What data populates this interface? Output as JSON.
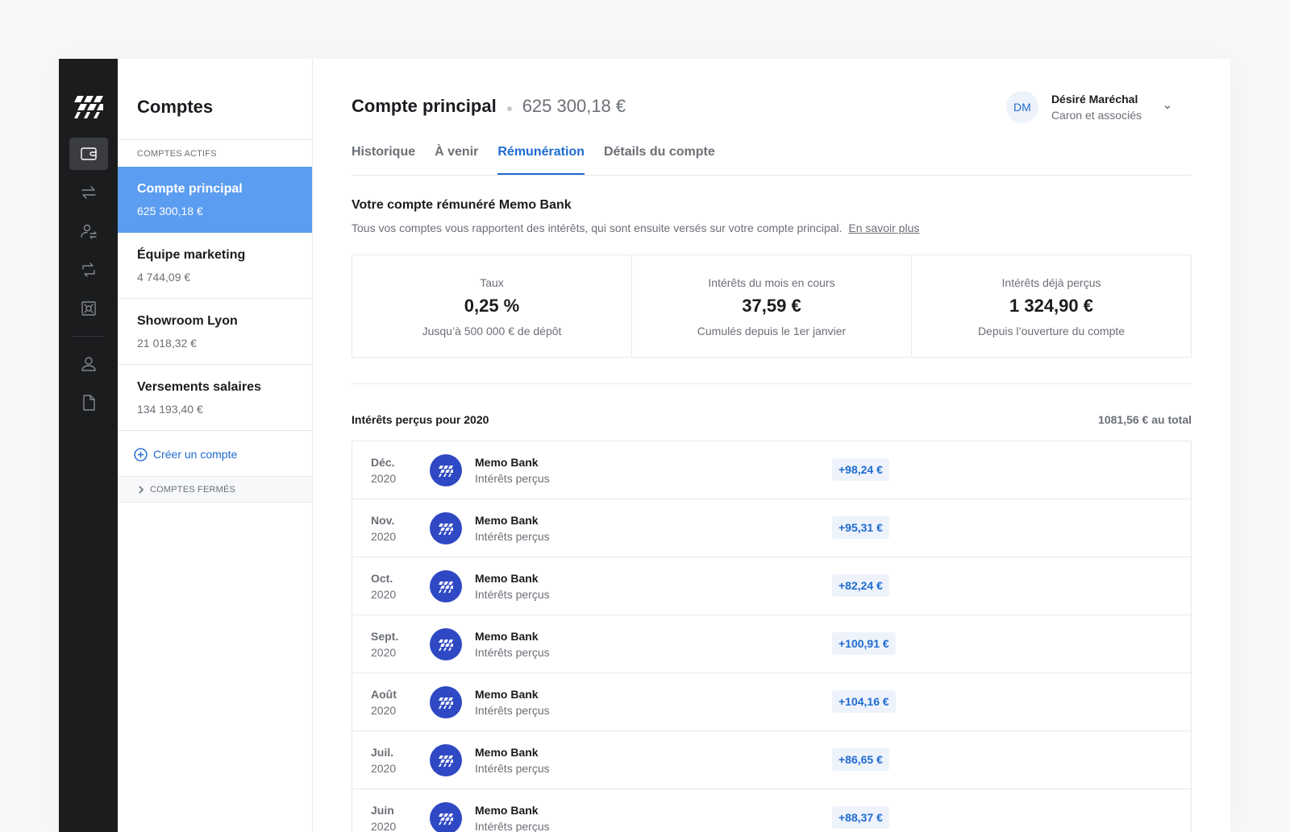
{
  "accounts_panel": {
    "title": "Comptes",
    "active_section": "COMPTES ACTIFS",
    "items": [
      {
        "name": "Compte principal",
        "balance": "625 300,18 €"
      },
      {
        "name": "Équipe marketing",
        "balance": "4 744,09 €"
      },
      {
        "name": "Showroom Lyon",
        "balance": "21 018,32 €"
      },
      {
        "name": "Versements salaires",
        "balance": "134 193,40 €"
      }
    ],
    "create_label": "Créer un compte",
    "closed_section": "COMPTES FERMÉS"
  },
  "header": {
    "account_name": "Compte principal",
    "account_balance": "625 300,18 €",
    "user_initials": "DM",
    "user_name": "Désiré Maréchal",
    "user_company": "Caron et associés"
  },
  "tabs": [
    "Historique",
    "À venir",
    "Rémunération",
    "Détails du compte"
  ],
  "active_tab": "Rémunération",
  "intro": {
    "title": "Votre compte rémunéré Memo Bank",
    "text": "Tous vos comptes vous rapportent des intérêts, qui sont ensuite versés sur votre compte principal.",
    "link": "En savoir plus"
  },
  "stats": [
    {
      "label": "Taux",
      "value": "0,25 %",
      "sub": "Jusqu’à 500 000 € de dépôt"
    },
    {
      "label": "Intérêts du mois en cours",
      "value": "37,59 €",
      "sub": "Cumulés depuis le 1er janvier"
    },
    {
      "label": "Intérêts déjà perçus",
      "value": "1 324,90 €",
      "sub": "Depuis l’ouverture du compte"
    }
  ],
  "interest_list": {
    "title": "Intérêts perçus pour 2020",
    "total": "1081,56 € au total",
    "rows": [
      {
        "month": "Déc.",
        "year": "2020",
        "party": "Memo Bank",
        "desc": "Intérêts perçus",
        "amount": "+98,24 €"
      },
      {
        "month": "Nov.",
        "year": "2020",
        "party": "Memo Bank",
        "desc": "Intérêts perçus",
        "amount": "+95,31 €"
      },
      {
        "month": "Oct.",
        "year": "2020",
        "party": "Memo Bank",
        "desc": "Intérêts perçus",
        "amount": "+82,24 €"
      },
      {
        "month": "Sept.",
        "year": "2020",
        "party": "Memo Bank",
        "desc": "Intérêts perçus",
        "amount": "+100,91 €"
      },
      {
        "month": "Août",
        "year": "2020",
        "party": "Memo Bank",
        "desc": "Intérêts perçus",
        "amount": "+104,16 €"
      },
      {
        "month": "Juil.",
        "year": "2020",
        "party": "Memo Bank",
        "desc": "Intérêts perçus",
        "amount": "+86,65 €"
      },
      {
        "month": "Juin",
        "year": "2020",
        "party": "Memo Bank",
        "desc": "Intérêts perçus",
        "amount": "+88,37 €"
      }
    ]
  },
  "colors": {
    "accent": "#1e6bd1",
    "active_account_bg": "#5b9df1",
    "bank_logo_bg": "#2f49c4",
    "rail_bg": "#1b1c1e"
  },
  "rail_icons": [
    "wallet-icon",
    "transfer-icon",
    "beneficiary-icon",
    "recurring-transfer-icon",
    "safe-icon",
    "user-icon",
    "document-icon"
  ]
}
